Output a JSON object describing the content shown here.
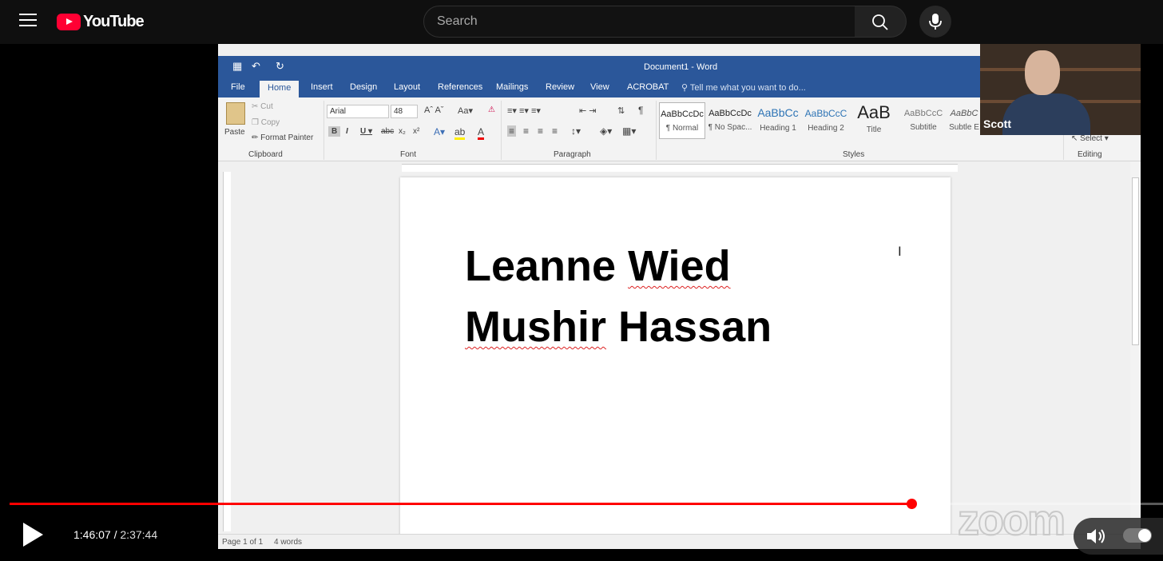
{
  "youtube": {
    "logo_text": "YouTube",
    "search_placeholder": "Search"
  },
  "word": {
    "window_title": "Document1 - Word",
    "tabs": [
      "File",
      "Home",
      "Insert",
      "Design",
      "Layout",
      "References",
      "Mailings",
      "Review",
      "View",
      "ACROBAT"
    ],
    "tell_me": "Tell me what you want to do...",
    "clipboard": {
      "paste": "Paste",
      "cut": "Cut",
      "copy": "Copy",
      "format_painter": "Format Painter",
      "label": "Clipboard"
    },
    "font": {
      "name": "Arial",
      "size": "48",
      "label": "Font"
    },
    "paragraph_label": "Paragraph",
    "styles": {
      "items": [
        {
          "preview": "AaBbCcDc",
          "name": "¶ Normal"
        },
        {
          "preview": "AaBbCcDc",
          "name": "¶ No Spac..."
        },
        {
          "preview": "AaBbCc",
          "name": "Heading 1"
        },
        {
          "preview": "AaBbCcC",
          "name": "Heading 2"
        },
        {
          "preview": "AaB",
          "name": "Title"
        },
        {
          "preview": "AaBbCcC",
          "name": "Subtitle"
        },
        {
          "preview": "AaBbC",
          "name": "Subtle E"
        }
      ],
      "label": "Styles"
    },
    "editing": {
      "select": "Select",
      "label": "Editing"
    },
    "document_lines": [
      "Leanne Wied",
      "Mushir Hassan"
    ],
    "status": {
      "page": "Page 1 of 1",
      "words": "4 words"
    },
    "zoom_watermark": "zoom"
  },
  "camera": {
    "name": "Scott"
  },
  "player": {
    "current_time": "1:46:07",
    "separator": " / ",
    "duration": "2:37:44",
    "progress_fraction": 0.782
  }
}
